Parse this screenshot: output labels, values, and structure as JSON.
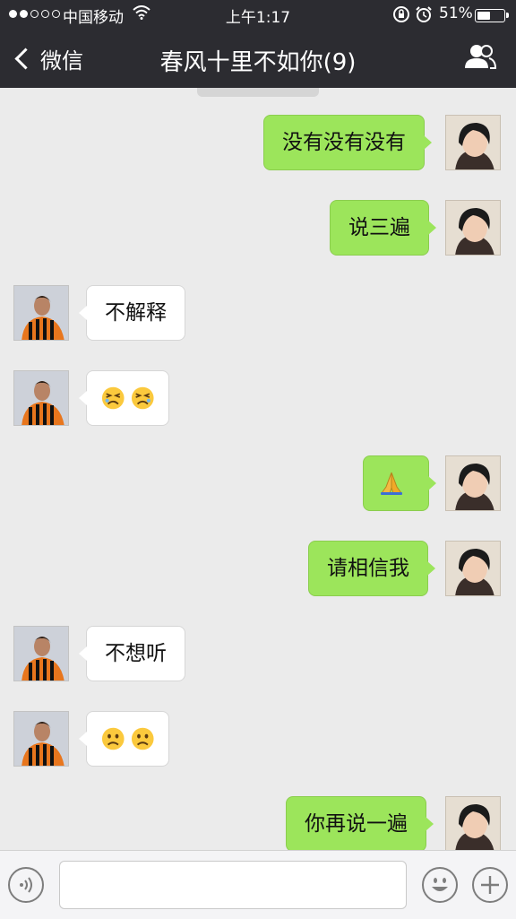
{
  "status_bar": {
    "carrier": "中国移动",
    "time": "上午1:17",
    "battery_percent": "51%",
    "signal_bars": 2,
    "battery_level": 0.51
  },
  "nav": {
    "back_label": "微信",
    "title": "春风十里不如你(9)"
  },
  "messages": [
    {
      "side": "out",
      "text": "没有没有没有"
    },
    {
      "side": "out",
      "text": "说三遍"
    },
    {
      "side": "in",
      "text": "不解释"
    },
    {
      "side": "in",
      "emoji": [
        "persevering-face",
        "persevering-face"
      ]
    },
    {
      "side": "out",
      "emoji": [
        "folded-hands"
      ]
    },
    {
      "side": "out",
      "text": "请相信我"
    },
    {
      "side": "in",
      "text": "不想听"
    },
    {
      "side": "in",
      "emoji": [
        "frowning-face",
        "frowning-face"
      ]
    },
    {
      "side": "out",
      "text": "你再说一遍"
    }
  ],
  "input_bar": {
    "text_value": ""
  },
  "colors": {
    "header_bg": "#2c2c31",
    "chat_bg": "#ebebeb",
    "outgoing_bubble": "#9ce55b",
    "incoming_bubble": "#ffffff"
  }
}
